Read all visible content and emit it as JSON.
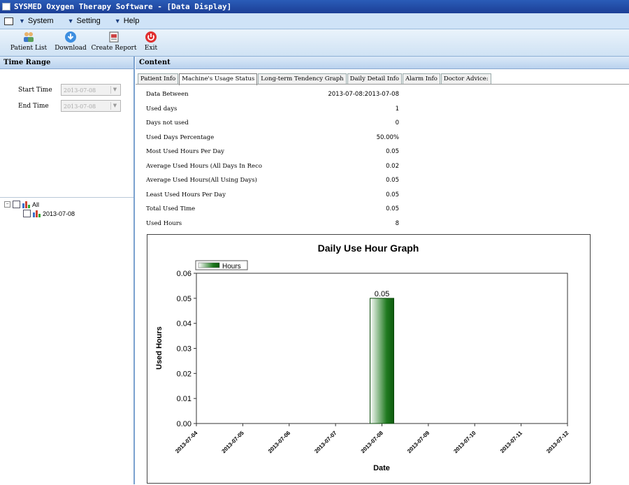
{
  "window": {
    "title": "SYSMED Oxygen Therapy Software - [Data Display]"
  },
  "menubar": {
    "items": [
      "System",
      "Setting",
      "Help"
    ]
  },
  "toolbar": {
    "buttons": [
      "Patient List",
      "Download",
      "Create Report",
      "Exit"
    ]
  },
  "left_pane": {
    "header": "Time Range",
    "start_time": {
      "label": "Start Time",
      "value": "2013-07-08"
    },
    "end_time": {
      "label": "End Time",
      "value": "2013-07-08"
    },
    "tree": {
      "root_label": "All",
      "child_label": "2013-07-08"
    }
  },
  "right_pane": {
    "header": "Content",
    "tabs": [
      "Patient Info",
      "Machine's Usage Status",
      "Long-term Tendency Graph",
      "Daily Detail Info",
      "Alarm Info",
      "Doctor Advice:"
    ],
    "active_tab": 1,
    "stats": [
      {
        "label": "Data Between",
        "value": "2013-07-08:2013-07-08"
      },
      {
        "label": "Used days",
        "value": "1"
      },
      {
        "label": "Days not used",
        "value": "0"
      },
      {
        "label": "Used Days Percentage",
        "value": "50.00%"
      },
      {
        "label": "Most Used Hours Per Day",
        "value": "0.05"
      },
      {
        "label": "Average Used Hours (All Days In Reco",
        "value": "0.02"
      },
      {
        "label": "Average Used Hours(All Using Days)",
        "value": "0.05"
      },
      {
        "label": "Least Used Hours Per Day",
        "value": "0.05"
      },
      {
        "label": "Total Used Time",
        "value": "0.05"
      },
      {
        "label": "Used Hours",
        "value": "8"
      }
    ]
  },
  "chart_data": {
    "type": "bar",
    "title": "Daily Use Hour Graph",
    "xlabel": "Date",
    "ylabel": "Used Hours",
    "legend": {
      "position": "top-left",
      "entries": [
        "Hours"
      ]
    },
    "categories": [
      "2013-07-04",
      "2013-07-05",
      "2013-07-06",
      "2013-07-07",
      "2013-07-08",
      "2013-07-09",
      "2013-07-10",
      "2013-07-11",
      "2013-07-12"
    ],
    "series": [
      {
        "name": "Hours",
        "values": [
          null,
          null,
          null,
          null,
          0.05,
          null,
          null,
          null,
          null
        ]
      }
    ],
    "data_labels": [
      "",
      "",
      "",
      "",
      "0.05",
      "",
      "",
      "",
      ""
    ],
    "ylim": [
      0,
      0.06
    ],
    "yticks": [
      "0.00",
      "0.01",
      "0.02",
      "0.03",
      "0.04",
      "0.05",
      "0.06"
    ],
    "grid": false,
    "bar_color": "#1f7a1f"
  }
}
